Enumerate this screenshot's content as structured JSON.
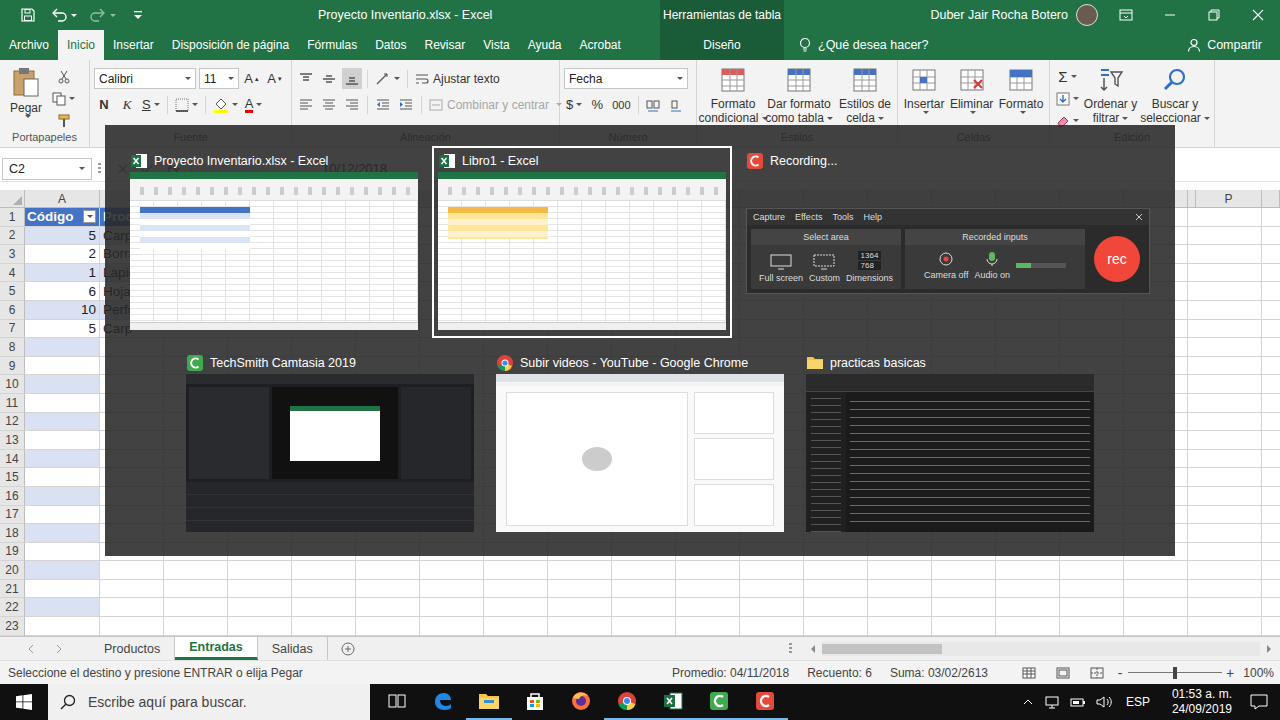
{
  "window": {
    "title": "Proyecto Inventario.xlsx - Excel",
    "context_group": "Herramientas de tabla",
    "user": "Duber Jair Rocha Botero"
  },
  "ribbon_tabs": [
    {
      "label": "Archivo",
      "selected": false,
      "kind": "normal"
    },
    {
      "label": "Inicio",
      "selected": true,
      "kind": "normal"
    },
    {
      "label": "Insertar",
      "selected": false,
      "kind": "normal"
    },
    {
      "label": "Disposición de página",
      "selected": false,
      "kind": "normal"
    },
    {
      "label": "Fórmulas",
      "selected": false,
      "kind": "normal"
    },
    {
      "label": "Datos",
      "selected": false,
      "kind": "normal"
    },
    {
      "label": "Revisar",
      "selected": false,
      "kind": "normal"
    },
    {
      "label": "Vista",
      "selected": false,
      "kind": "normal"
    },
    {
      "label": "Ayuda",
      "selected": false,
      "kind": "normal"
    },
    {
      "label": "Acrobat",
      "selected": false,
      "kind": "normal"
    },
    {
      "label": "Diseño",
      "selected": false,
      "kind": "contextual"
    }
  ],
  "tell_me": "¿Qué desea hacer?",
  "share": "Compartir",
  "ribbon": {
    "groups": {
      "clipboard": "Portapapeles",
      "font": "Fuente",
      "alignment": "Alineación",
      "number": "Número",
      "styles": "Estilos",
      "cells": "Celdas",
      "editing": "Edición"
    },
    "paste": "Pegar",
    "font_name": "Calibri",
    "font_size": "11",
    "grow": "A",
    "shrink": "A",
    "bold": "N",
    "italic": "K",
    "underline": "S",
    "font_color": "A",
    "wrap_text": "Ajustar texto",
    "merge": {
      "label": "Combinar y centrar",
      "disabled": true
    },
    "number_format": "Fecha",
    "currency": "$",
    "percent": "%",
    "thousands": "000",
    "styles": [
      {
        "lines": [
          "Formato",
          "condicional"
        ]
      },
      {
        "lines": [
          "Dar formato",
          "como tabla"
        ]
      },
      {
        "lines": [
          "Estilos de",
          "celda"
        ]
      }
    ],
    "cells": [
      {
        "label": "Insertar"
      },
      {
        "label": "Eliminar"
      },
      {
        "label": "Formato"
      }
    ],
    "autosum": "Σ",
    "editing": [
      {
        "lines": [
          "Ordenar y",
          "filtrar"
        ]
      },
      {
        "lines": [
          "Buscar y",
          "seleccionar"
        ]
      }
    ]
  },
  "formula_bar": {
    "name_box": "C2",
    "value": "10/12/2018"
  },
  "sheet": {
    "visible_columns": {
      "left": "A",
      "right": "P"
    },
    "header": {
      "code": "Código",
      "product": "Prod"
    },
    "rows": [
      {
        "code": "5",
        "product": "Carp"
      },
      {
        "code": "2",
        "product": "Borra"
      },
      {
        "code": "1",
        "product": "Lapic"
      },
      {
        "code": "6",
        "product": "Hoja"
      },
      {
        "code": "10",
        "product": "Perfo"
      },
      {
        "code": "5",
        "product": "Carp"
      }
    ],
    "row_numbers": [
      "1",
      "2",
      "3",
      "4",
      "5",
      "6",
      "7",
      "8",
      "9",
      "10",
      "11",
      "12",
      "13",
      "14",
      "15",
      "16",
      "17",
      "18",
      "19",
      "20",
      "21",
      "22",
      "23"
    ]
  },
  "sheet_tabs": [
    {
      "label": "Productos",
      "selected": false
    },
    {
      "label": "Entradas",
      "selected": true
    },
    {
      "label": "Salidas",
      "selected": false
    }
  ],
  "status_bar": {
    "message": "Seleccione el destino y presione ENTRAR o elija Pegar",
    "average": "Promedio: 04/11/2018",
    "count": "Recuento: 6",
    "sum": "Suma: 03/02/2613",
    "zoom_out": "-",
    "zoom_in": "+",
    "zoom": "100%",
    "zoom_level": 0.5
  },
  "switcher": {
    "windows": [
      {
        "title": "Proyecto Inventario.xlsx - Excel",
        "kind": "excel",
        "yellow_cells": false,
        "selected": false
      },
      {
        "title": "Libro1 - Excel",
        "kind": "excel",
        "yellow_cells": true,
        "selected": true
      },
      {
        "title": "Recording...",
        "kind": "recorder",
        "yellow_cells": false,
        "selected": false
      },
      {
        "title": "TechSmith Camtasia 2019",
        "kind": "camtasia",
        "yellow_cells": false,
        "selected": false
      },
      {
        "title": "Subir videos - YouTube - Google Chrome",
        "kind": "chrome",
        "yellow_cells": false,
        "selected": false
      },
      {
        "title": "practicas basicas",
        "kind": "explorer",
        "yellow_cells": false,
        "selected": false
      }
    ],
    "recorder": {
      "menu": [
        "Capture",
        "Effects",
        "Tools",
        "Help"
      ],
      "select_area": "Select area",
      "full_screen": "Full screen",
      "custom": "Custom",
      "dimensions": "Dimensions",
      "width": "1364",
      "height": "768",
      "recorded_inputs": "Recorded inputs",
      "camera": "Camera off",
      "audio": "Audio on",
      "audio_level": 0.3,
      "rec": "rec"
    }
  },
  "taskbar": {
    "search_placeholder": "Escribe aquí para buscar.",
    "apps": [
      {
        "kind": "task-view",
        "running": false
      },
      {
        "kind": "edge",
        "running": false
      },
      {
        "kind": "explorer",
        "running": true
      },
      {
        "kind": "store",
        "running": false
      },
      {
        "kind": "firefox",
        "running": false
      },
      {
        "kind": "chrome",
        "running": true
      },
      {
        "kind": "excel",
        "running": true
      },
      {
        "kind": "camtasia",
        "running": true
      },
      {
        "kind": "recorder",
        "running": true
      }
    ],
    "language": "ESP",
    "time": "01:53 a. m.",
    "date": "24/09/2019"
  }
}
